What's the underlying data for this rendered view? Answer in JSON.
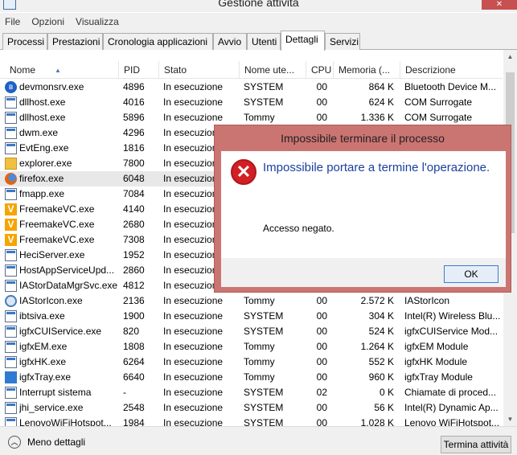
{
  "window": {
    "title": "Gestione attività"
  },
  "menu": [
    "File",
    "Opzioni",
    "Visualizza"
  ],
  "tabs": [
    "Processi",
    "Prestazioni",
    "Cronologia applicazioni",
    "Avvio",
    "Utenti",
    "Dettagli",
    "Servizi"
  ],
  "active_tab": "Dettagli",
  "columns": [
    "Nome",
    "PID",
    "Stato",
    "Nome ute...",
    "CPU",
    "Memoria (...",
    "Descrizione"
  ],
  "rows": [
    {
      "icon": "bluetooth-icon",
      "name": "devmonsrv.exe",
      "pid": "4896",
      "stato": "In esecuzione",
      "user": "SYSTEM",
      "cpu": "00",
      "mem": "864 K",
      "desc": "Bluetooth Device M..."
    },
    {
      "icon": "window-icon",
      "name": "dllhost.exe",
      "pid": "4016",
      "stato": "In esecuzione",
      "user": "SYSTEM",
      "cpu": "00",
      "mem": "624 K",
      "desc": "COM Surrogate"
    },
    {
      "icon": "window-icon",
      "name": "dllhost.exe",
      "pid": "5896",
      "stato": "In esecuzione",
      "user": "Tommy",
      "cpu": "00",
      "mem": "1.336 K",
      "desc": "COM Surrogate"
    },
    {
      "icon": "window-icon",
      "name": "dwm.exe",
      "pid": "4296",
      "stato": "In esecuzione",
      "user": "",
      "cpu": "",
      "mem": "",
      "desc": ""
    },
    {
      "icon": "window-icon",
      "name": "EvtEng.exe",
      "pid": "1816",
      "stato": "In esecuzione",
      "user": "",
      "cpu": "",
      "mem": "",
      "desc": ""
    },
    {
      "icon": "folder-icon",
      "name": "explorer.exe",
      "pid": "7800",
      "stato": "In esecuzione",
      "user": "",
      "cpu": "",
      "mem": "",
      "desc": ""
    },
    {
      "icon": "firefox-icon",
      "name": "firefox.exe",
      "pid": "6048",
      "stato": "In esecuzione",
      "user": "",
      "cpu": "",
      "mem": "",
      "desc": "",
      "selected": true
    },
    {
      "icon": "window-icon",
      "name": "fmapp.exe",
      "pid": "7084",
      "stato": "In esecuzione",
      "user": "",
      "cpu": "",
      "mem": "",
      "desc": ""
    },
    {
      "icon": "freemake-icon",
      "name": "FreemakeVC.exe",
      "pid": "4140",
      "stato": "In esecuzione",
      "user": "",
      "cpu": "",
      "mem": "",
      "desc": ""
    },
    {
      "icon": "freemake-icon",
      "name": "FreemakeVC.exe",
      "pid": "2680",
      "stato": "In esecuzione",
      "user": "",
      "cpu": "",
      "mem": "",
      "desc": ""
    },
    {
      "icon": "freemake-icon",
      "name": "FreemakeVC.exe",
      "pid": "7308",
      "stato": "In esecuzione",
      "user": "",
      "cpu": "",
      "mem": "",
      "desc": ""
    },
    {
      "icon": "window-icon",
      "name": "HeciServer.exe",
      "pid": "1952",
      "stato": "In esecuzione",
      "user": "",
      "cpu": "",
      "mem": "",
      "desc": ""
    },
    {
      "icon": "window-icon",
      "name": "HostAppServiceUpd...",
      "pid": "2860",
      "stato": "In esecuzione",
      "user": "",
      "cpu": "",
      "mem": "",
      "desc": ""
    },
    {
      "icon": "window-icon",
      "name": "IAStorDataMgrSvc.exe",
      "pid": "4812",
      "stato": "In esecuzione",
      "user": "",
      "cpu": "",
      "mem": "",
      "desc": ""
    },
    {
      "icon": "gear-icon",
      "name": "IAStorIcon.exe",
      "pid": "2136",
      "stato": "In esecuzione",
      "user": "Tommy",
      "cpu": "00",
      "mem": "2.572 K",
      "desc": "IAStorIcon"
    },
    {
      "icon": "window-icon",
      "name": "ibtsiva.exe",
      "pid": "1900",
      "stato": "In esecuzione",
      "user": "SYSTEM",
      "cpu": "00",
      "mem": "304 K",
      "desc": "Intel(R) Wireless Blu..."
    },
    {
      "icon": "window-icon",
      "name": "igfxCUIService.exe",
      "pid": "820",
      "stato": "In esecuzione",
      "user": "SYSTEM",
      "cpu": "00",
      "mem": "524 K",
      "desc": "igfxCUIService Mod..."
    },
    {
      "icon": "window-icon",
      "name": "igfxEM.exe",
      "pid": "1808",
      "stato": "In esecuzione",
      "user": "Tommy",
      "cpu": "00",
      "mem": "1.264 K",
      "desc": "igfxEM Module"
    },
    {
      "icon": "window-icon",
      "name": "igfxHK.exe",
      "pid": "6264",
      "stato": "In esecuzione",
      "user": "Tommy",
      "cpu": "00",
      "mem": "552 K",
      "desc": "igfxHK Module"
    },
    {
      "icon": "tray-icon",
      "name": "igfxTray.exe",
      "pid": "6640",
      "stato": "In esecuzione",
      "user": "Tommy",
      "cpu": "00",
      "mem": "960 K",
      "desc": "igfxTray Module"
    },
    {
      "icon": "window-icon",
      "name": "Interrupt sistema",
      "pid": "-",
      "stato": "In esecuzione",
      "user": "SYSTEM",
      "cpu": "02",
      "mem": "0 K",
      "desc": "Chiamate di proced..."
    },
    {
      "icon": "window-icon",
      "name": "jhi_service.exe",
      "pid": "2548",
      "stato": "In esecuzione",
      "user": "SYSTEM",
      "cpu": "00",
      "mem": "56 K",
      "desc": "Intel(R) Dynamic Ap..."
    },
    {
      "icon": "window-icon",
      "name": "LenovoWiFiHotspot...",
      "pid": "1984",
      "stato": "In esecuzione",
      "user": "SYSTEM",
      "cpu": "00",
      "mem": "1.028 K",
      "desc": "Lenovo WiFiHotspot..."
    }
  ],
  "footer": {
    "less_details": "Meno dettagli",
    "end_task": "Termina attività"
  },
  "dialog": {
    "title": "Impossibile terminare il processo",
    "main_instruction": "Impossibile portare a termine l'operazione.",
    "content": "Accesso negato.",
    "ok": "OK"
  }
}
